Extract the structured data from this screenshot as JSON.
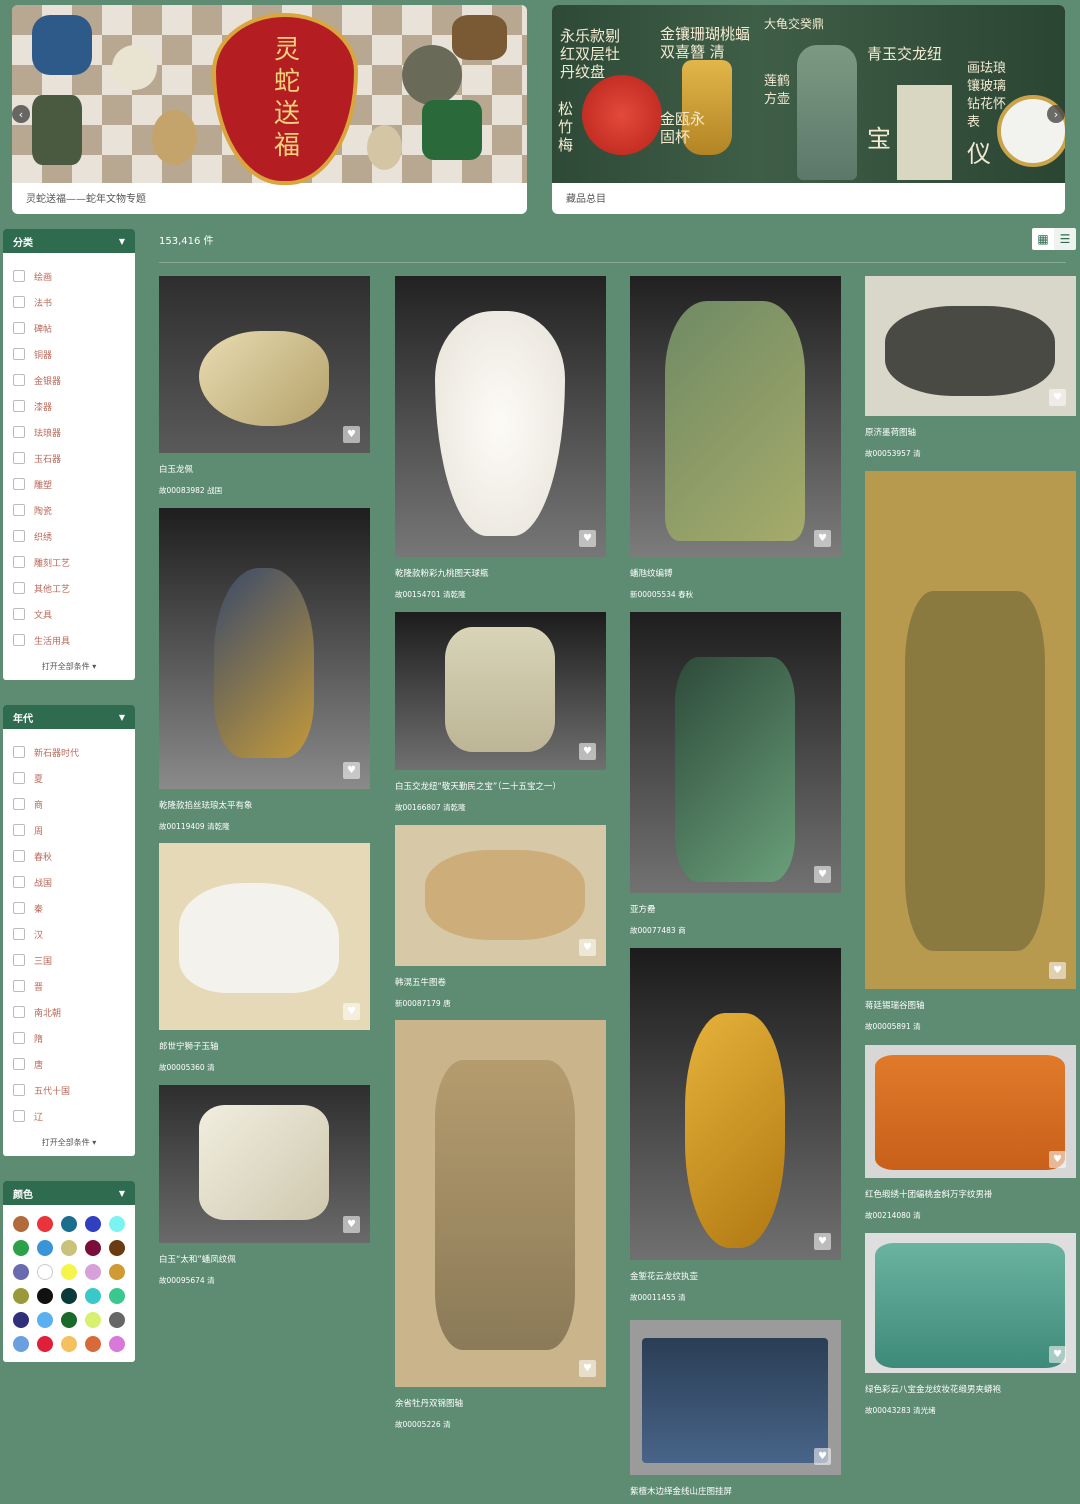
{
  "banners": [
    {
      "caption": "灵蛇送福——蛇年文物专题",
      "art_text": "灵蛇送福"
    },
    {
      "caption": "藏品总目",
      "art_texts": [
        "永乐款剔红双层牡丹纹盘",
        "金镶珊瑚桃蝠双喜簪 清",
        "大龟交癸鼎",
        "青玉交龙纽",
        "画珐琅镶玻璃钻花怀表",
        "松竹梅",
        "金瓯永固杯",
        "莲鹤方壶",
        "宝",
        "仪"
      ]
    }
  ],
  "filters": {
    "category": {
      "title": "分类",
      "items": [
        "绘画",
        "法书",
        "碑帖",
        "铜器",
        "金银器",
        "漆器",
        "珐琅器",
        "玉石器",
        "雕塑",
        "陶瓷",
        "织绣",
        "雕刻工艺",
        "其他工艺",
        "文具",
        "生活用具"
      ],
      "expand": "打开全部条件"
    },
    "era": {
      "title": "年代",
      "items": [
        "新石器时代",
        "夏",
        "商",
        "周",
        "春秋",
        "战国",
        "秦",
        "汉",
        "三国",
        "晋",
        "南北朝",
        "隋",
        "唐",
        "五代十国",
        "辽"
      ],
      "expand": "打开全部条件"
    },
    "color": {
      "title": "颜色",
      "swatches": [
        "#b26a3c",
        "#e8343a",
        "#1a6e8e",
        "#3040c0",
        "#7bf3f3",
        "#2fa04a",
        "#3b93d8",
        "#c8c27a",
        "#7a0e3a",
        "#6a3b10",
        "#6a6ab0",
        "#ffffff",
        "#f4f44a",
        "#d8a0d8",
        "#d09a34",
        "#9a9a3a",
        "#111111",
        "#0a3a3a",
        "#3ac8c8",
        "#3ac890",
        "#30307a",
        "#5ab0f0",
        "#1a6a2a",
        "#d8f070",
        "#666666",
        "#6aa0e0",
        "#e0203a",
        "#f4c060",
        "#d86a3a",
        "#d878d8"
      ]
    }
  },
  "result_count": "153,416 件",
  "view_icons": [
    "grid-icon",
    "list-icon"
  ],
  "items": [
    {
      "title": "白玉龙佩",
      "code": "故00083982",
      "era": "战国"
    },
    {
      "title": "乾隆款掐丝珐琅太平有象",
      "code": "故00119409",
      "era": "清乾隆"
    },
    {
      "title": "郎世宁狮子玉轴",
      "code": "故00005360",
      "era": "清"
    },
    {
      "title": "白玉“太和”蟠凤纹佩",
      "code": "故00095674",
      "era": "清"
    },
    {
      "title": "乾隆款粉彩九桃图天球瓶",
      "code": "故00154701",
      "era": "清乾隆"
    },
    {
      "title": "白玉交龙纽“敬天勤民之宝”（二十五宝之一）",
      "code": "故00166807",
      "era": "清乾隆"
    },
    {
      "title": "韩滉五牛图卷",
      "code": "新00087179",
      "era": "唐"
    },
    {
      "title": "余省牡丹双锦图轴",
      "code": "故00005226",
      "era": "清"
    },
    {
      "title": "蟠虺纹编镈",
      "code": "新00005534",
      "era": "春秋"
    },
    {
      "title": "亚𠙵方罍",
      "code": "故00077483",
      "era": "商"
    },
    {
      "title": "金錾花云龙纹执壶",
      "code": "故00011455",
      "era": "清"
    },
    {
      "title": "紫檀木边缂金线山庄图挂屏",
      "code": "",
      "era": ""
    },
    {
      "title": "原济墨荷图轴",
      "code": "故00053957",
      "era": "清"
    },
    {
      "title": "蒋廷锡瑞谷图轴",
      "code": "故00005891",
      "era": "清"
    },
    {
      "title": "红色缎绣十团蝠桃金斜万字纹男褂",
      "code": "故00214080",
      "era": "清"
    },
    {
      "title": "绿色彩云八宝金龙纹妆花缎男夹蟒袍",
      "code": "故00043283",
      "era": "清光绪"
    }
  ]
}
